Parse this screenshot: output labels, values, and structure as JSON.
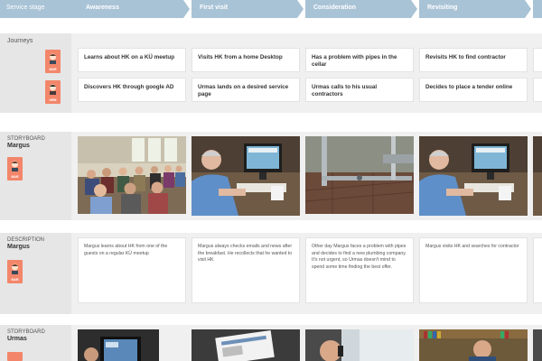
{
  "stages": {
    "label": "Service stage",
    "items": [
      "Awareness",
      "First visit",
      "Consideration",
      "Revisiting",
      ""
    ]
  },
  "journeys": {
    "label": "Journeys",
    "margus_tag": "MAR",
    "urmas_tag": "URM",
    "row1": [
      "Learns about HK on a KÜ meetup",
      "Visits HK from a home Desktop",
      "Has a problem with pipes in the cellar",
      "Revisits HK to find contractor",
      ""
    ],
    "row2": [
      "Discovers HK through google AD",
      "Urmas lands on a desired service page",
      "Urmas calls to his usual contractors",
      "Decides to place a tender online",
      ""
    ]
  },
  "storyboard_margus": {
    "sub": "STORYBOARD",
    "name": "Margus",
    "tag": "MAR"
  },
  "description_margus": {
    "sub": "DESCRIPTION",
    "name": "Margus",
    "tag": "MAR",
    "items": [
      "Margus learns about HK from one of the guests on a regular KÜ meetup",
      "Margus always checks emails and news after the breakfast. He recollects that he wanted to visit HK",
      "Other day Margus faces a problem with pipes and decides to find a new plumbing company. It's not urgent, so Urmas doesn't mind to spend some time finding the best offer.",
      "Margus visits HK and searches for contractor",
      ""
    ]
  },
  "storyboard_urmas": {
    "sub": "STORYBOARD",
    "name": "Urmas"
  }
}
